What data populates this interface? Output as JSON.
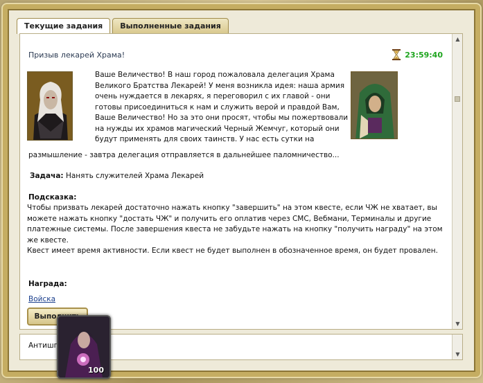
{
  "tabs": [
    {
      "label": "Текущие задания",
      "active": true
    },
    {
      "label": "Выполненные задания",
      "active": false
    }
  ],
  "quest": {
    "title": "Призыв лекарей Храма!",
    "timer": "23:59:40",
    "intro": "Ваше Величество! В наш город пожаловала делегация Храма Великого Братства Лекарей! У меня возникла идея: наша армия очень нуждается в лекарях, я переговорил с их главой - они готовы присоединиться к нам и служить верой и правдой Вам, Ваше Величество! Но за это они просят, чтобы мы пожертвовали на нужды их храмов магический Черный Жемчуг, который они будут применять для своих таинств. У нас есть сутки на",
    "intro_tail": "размышление - завтра делегация отправляется в дальнейшее паломничество...",
    "task_label": "Задача:",
    "task_text": "Нанять служителей Храма Лекарей",
    "hint_label": "Подсказка:",
    "hint_text": "Чтобы призвать лекарей достаточно нажать кнопку \"завершить\" на этом квесте, если ЧЖ не хватает, вы можете нажать кнопку \"достать ЧЖ\" и получить его оплатив через СМС, Вебмани, Терминалы и другие платежные системы. После завершения квеста не забудьте нажать на кнопку \"получить награду\" на этом же квесте.",
    "hint_note": " Квест имеет время активности. Если квест не будет выполнен в обозначенное время, он будет провален.",
    "reward_label": "Награда:",
    "reward_link": "Войска",
    "complete_button": "Выполнить"
  },
  "second_quest": {
    "title": "Антишп"
  },
  "avatar": {
    "count": "100"
  },
  "colors": {
    "timer": "#1ea51e",
    "frame_gold": "#c5ad62",
    "link": "#1a3e8c"
  }
}
